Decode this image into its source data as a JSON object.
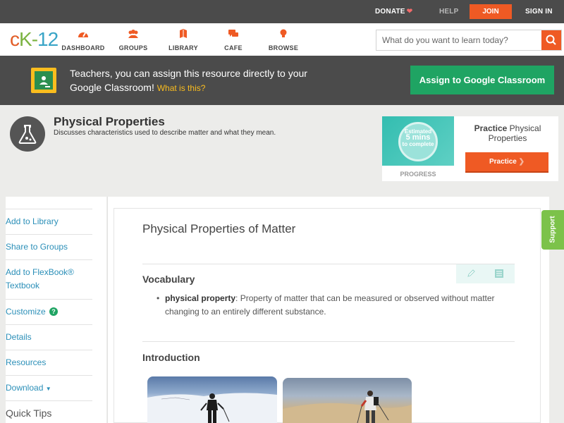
{
  "topbar": {
    "donate": "DONATE",
    "help": "HELP",
    "join": "JOIN",
    "signin": "SIGN IN"
  },
  "nav": {
    "logo": {
      "c": "c",
      "k": "K",
      "dash": "-",
      "n": "12"
    },
    "items": [
      {
        "label": "DASHBOARD",
        "icon": "dashboard-icon"
      },
      {
        "label": "GROUPS",
        "icon": "groups-icon"
      },
      {
        "label": "LIBRARY",
        "icon": "library-icon"
      },
      {
        "label": "CAFE",
        "icon": "cafe-icon"
      },
      {
        "label": "BROWSE",
        "icon": "browse-icon"
      }
    ],
    "search_placeholder": "What do you want to learn today?"
  },
  "banner": {
    "text": "Teachers, you can assign this resource directly to your Google Classroom!",
    "what": "What is this?",
    "button": "Assign to Google Classroom"
  },
  "header": {
    "title": "Physical Properties",
    "description": "Discusses characteristics used to describe matter and what they mean."
  },
  "practice": {
    "estimated": "Estimated",
    "mins": "5 mins",
    "complete": "to complete",
    "progress_label": "PROGRESS",
    "title_bold": "Practice",
    "title_rest": "Physical Properties",
    "button": "Practice"
  },
  "sidebar": {
    "items": [
      "Add to Library",
      "Share to Groups",
      "Add to FlexBook® Textbook",
      "Customize",
      "Details",
      "Resources",
      "Download",
      "Quick Tips"
    ]
  },
  "article": {
    "title": "Physical Properties of Matter",
    "vocab_heading": "Vocabulary",
    "term": "physical property",
    "definition": ": Property of matter that can be measured or observed without matter changing to an entirely different substance.",
    "intro_heading": "Introduction"
  },
  "support": "Support",
  "colors": {
    "accent": "#ef5a24",
    "google_green": "#1fa463",
    "link": "#2b8fb8",
    "dark_bar": "#4b4b4b"
  }
}
